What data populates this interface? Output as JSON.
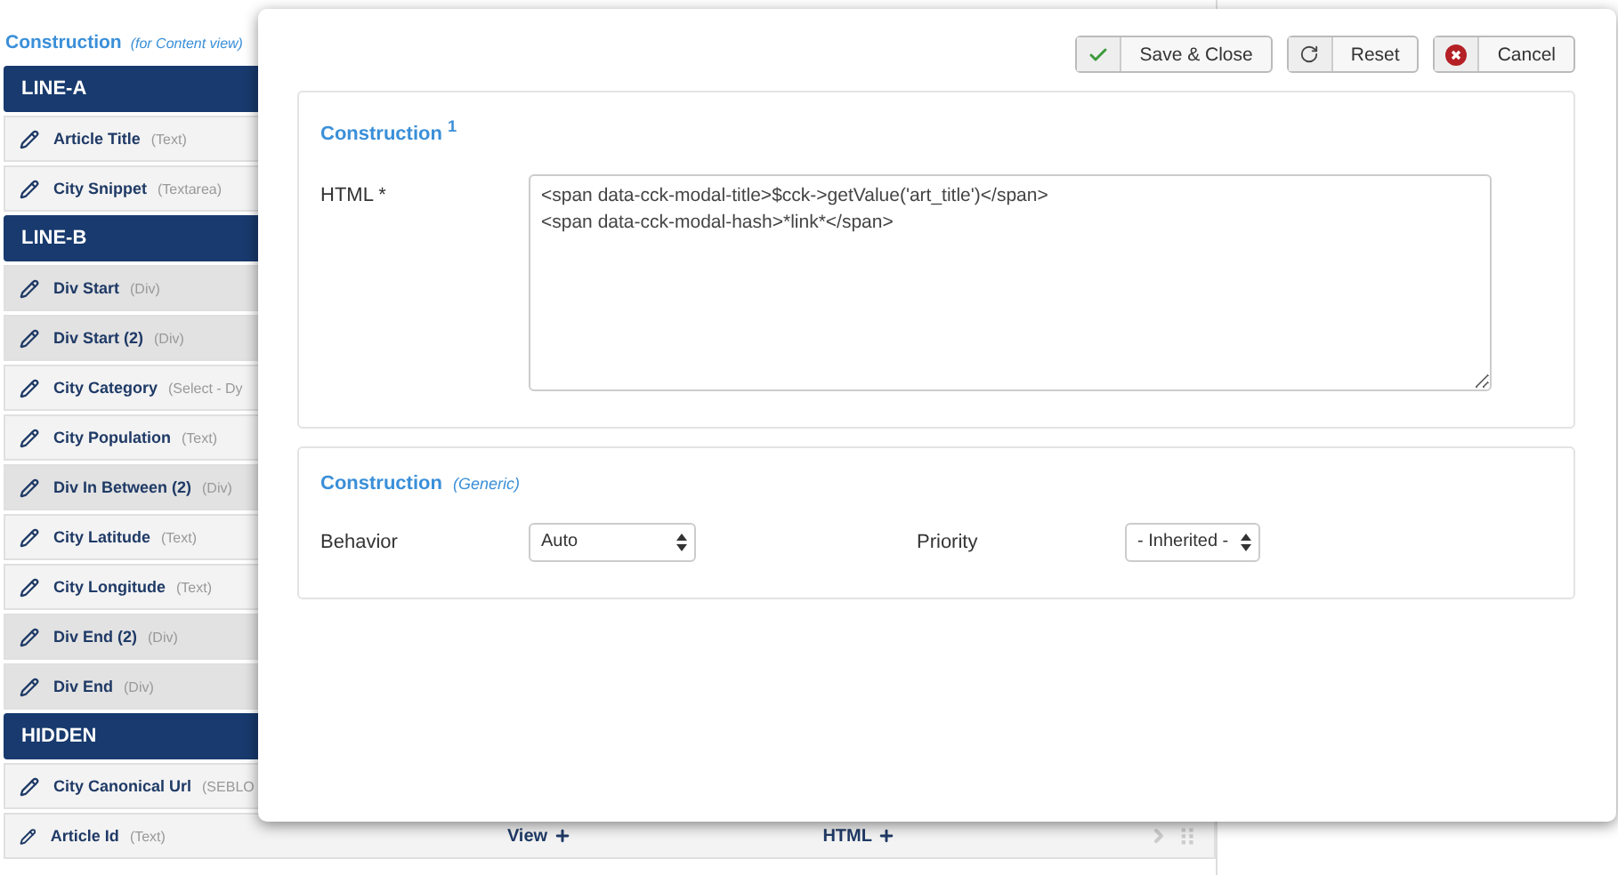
{
  "page": {
    "title": "Construction",
    "subtitle": "(for Content view)"
  },
  "list": [
    {
      "kind": "header",
      "label": "LINE-A"
    },
    {
      "kind": "field",
      "label": "Article Title",
      "type": "(Text)",
      "shaded": false
    },
    {
      "kind": "field",
      "label": "City Snippet",
      "type": "(Textarea)",
      "shaded": false
    },
    {
      "kind": "header",
      "label": "LINE-B"
    },
    {
      "kind": "field",
      "label": "Div Start",
      "type": "(Div)",
      "shaded": true
    },
    {
      "kind": "field",
      "label": "Div Start (2)",
      "type": "(Div)",
      "shaded": true
    },
    {
      "kind": "field",
      "label": "City Category",
      "type": "(Select - Dy",
      "shaded": false
    },
    {
      "kind": "field",
      "label": "City Population",
      "type": "(Text)",
      "shaded": false
    },
    {
      "kind": "field",
      "label": "Div In Between (2)",
      "type": "(Div)",
      "shaded": true
    },
    {
      "kind": "field",
      "label": "City Latitude",
      "type": "(Text)",
      "shaded": false
    },
    {
      "kind": "field",
      "label": "City Longitude",
      "type": "(Text)",
      "shaded": false
    },
    {
      "kind": "field",
      "label": "Div End (2)",
      "type": "(Div)",
      "shaded": true
    },
    {
      "kind": "field",
      "label": "Div End",
      "type": "(Div)",
      "shaded": true
    },
    {
      "kind": "header",
      "label": "HIDDEN"
    },
    {
      "kind": "field",
      "label": "City Canonical Url",
      "type": "(SEBLO",
      "shaded": false
    },
    {
      "kind": "field",
      "label": "Article Id",
      "type": "(Text)",
      "shaded": false,
      "links": [
        "View",
        "HTML"
      ]
    }
  ],
  "modal": {
    "buttons": [
      {
        "kind": "save",
        "label": "Save & Close"
      },
      {
        "kind": "reset",
        "label": "Reset"
      },
      {
        "kind": "cancel",
        "label": "Cancel"
      }
    ],
    "sections": [
      {
        "kind": "html",
        "title": "Construction $^{1}$",
        "label": "HTML *",
        "value": "<span data-cck-modal-title>$cck->getValue('art_title')</span>\n<span data-cck-modal-hash>*link*</span>"
      },
      {
        "kind": "selects",
        "title": "Construction",
        "subtitle": "(Generic)",
        "fields": [
          {
            "label": "Behavior",
            "value": "Auto"
          },
          {
            "label": "Priority",
            "value": "- Inherited -"
          }
        ]
      }
    ]
  }
}
